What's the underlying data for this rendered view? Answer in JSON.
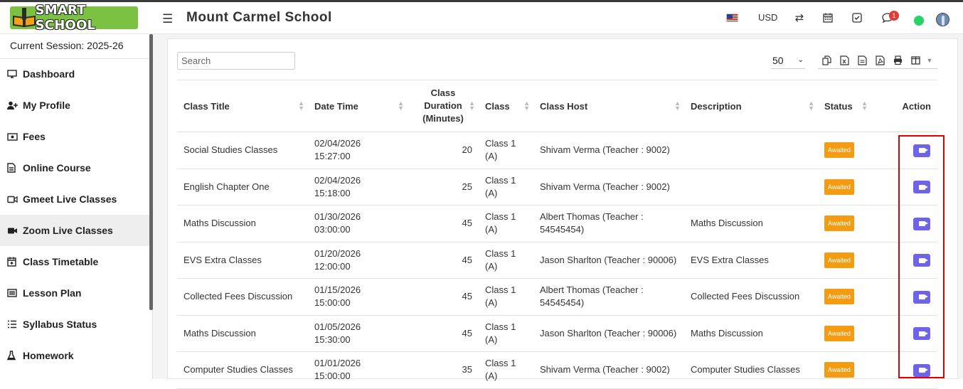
{
  "header": {
    "brand": "SMART SCHOOL",
    "school_name": "Mount Carmel School",
    "currency": "USD",
    "notification_count": "1"
  },
  "sidebar": {
    "session": "Current Session: 2025-26",
    "items": [
      {
        "label": "Dashboard",
        "icon": "monitor-icon"
      },
      {
        "label": "My Profile",
        "icon": "user-plus-icon"
      },
      {
        "label": "Fees",
        "icon": "money-icon"
      },
      {
        "label": "Online Course",
        "icon": "file-icon"
      },
      {
        "label": "Gmeet Live Classes",
        "icon": "video-icon"
      },
      {
        "label": "Zoom Live Classes",
        "icon": "video-icon",
        "active": true
      },
      {
        "label": "Class Timetable",
        "icon": "calendar-plus-icon"
      },
      {
        "label": "Lesson Plan",
        "icon": "list-icon"
      },
      {
        "label": "Syllabus Status",
        "icon": "list-ol-icon"
      },
      {
        "label": "Homework",
        "icon": "flask-icon"
      }
    ]
  },
  "toolbar": {
    "search_placeholder": "Search",
    "page_size": "50"
  },
  "table": {
    "columns": [
      "Class Title",
      "Date Time",
      "Class Duration (Minutes)",
      "Class",
      "Class Host",
      "Description",
      "Status",
      "Action"
    ],
    "rows": [
      {
        "title": "Social Studies Classes",
        "date": "02/04/2026",
        "time": "15:27:00",
        "duration": "20",
        "class": "Class 1",
        "section": "(A)",
        "host": "Shivam Verma (Teacher : 9002)",
        "description": "",
        "status": "Awaited"
      },
      {
        "title": "English Chapter One",
        "date": "02/04/2026",
        "time": "15:18:00",
        "duration": "25",
        "class": "Class 1",
        "section": "(A)",
        "host": "Shivam Verma (Teacher : 9002)",
        "description": "",
        "status": "Awaited"
      },
      {
        "title": "Maths Discussion",
        "date": "01/30/2026",
        "time": "03:00:00",
        "duration": "45",
        "class": "Class 1",
        "section": "(A)",
        "host": "Albert Thomas (Teacher : 54545454)",
        "description": "Maths Discussion",
        "status": "Awaited"
      },
      {
        "title": "EVS Extra Classes",
        "date": "01/20/2026",
        "time": "12:00:00",
        "duration": "45",
        "class": "Class 1",
        "section": "(A)",
        "host": "Jason Sharlton (Teacher : 90006)",
        "description": "EVS Extra Classes",
        "status": "Awaited"
      },
      {
        "title": "Collected Fees Discussion",
        "date": "01/15/2026",
        "time": "15:00:00",
        "duration": "45",
        "class": "Class 1",
        "section": "(A)",
        "host": "Albert Thomas (Teacher : 54545454)",
        "description": "Collected Fees Discussion",
        "status": "Awaited"
      },
      {
        "title": "Maths Discussion",
        "date": "01/05/2026",
        "time": "15:30:00",
        "duration": "45",
        "class": "Class 1",
        "section": "(A)",
        "host": "Jason Sharlton (Teacher : 90006)",
        "description": "Maths Discussion",
        "status": "Awaited"
      },
      {
        "title": "Computer Studies Classes",
        "date": "01/01/2026",
        "time": "15:00:00",
        "duration": "35",
        "class": "Class 1",
        "section": "(A)",
        "host": "Shivam Verma (Teacher : 9002)",
        "description": "Computer Studies Classes",
        "status": "Awaited"
      }
    ]
  },
  "colors": {
    "brand_green": "#7cc242",
    "status_awaited": "#f39c12",
    "action_button": "#6f63e8",
    "highlight": "#e00000"
  }
}
